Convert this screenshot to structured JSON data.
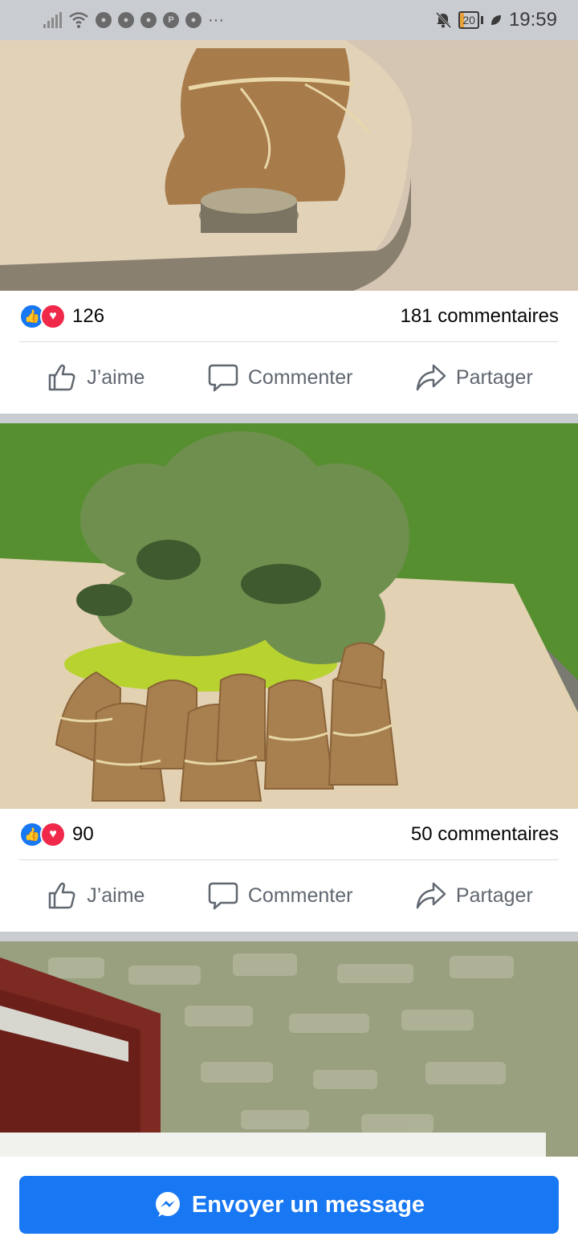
{
  "status_bar": {
    "time": "19:59",
    "battery": "20",
    "more": "···",
    "icons": [
      "signal-icon",
      "wifi-icon",
      "app-icon",
      "app-icon",
      "app-icon",
      "pinterest-icon",
      "app-icon",
      "mute-icon",
      "battery-icon",
      "leaf-icon"
    ]
  },
  "posts": [
    {
      "reaction_count": "126",
      "comment_count": "181 commentaires",
      "actions": {
        "like": "J’aime",
        "comment": "Commenter",
        "share": "Partager"
      }
    },
    {
      "reaction_count": "90",
      "comment_count": "50 commentaires",
      "actions": {
        "like": "J’aime",
        "comment": "Commenter",
        "share": "Partager"
      }
    }
  ],
  "message_button": {
    "label": "Envoyer un message"
  },
  "colors": {
    "accent": "#1877f2",
    "love": "#f02849",
    "muted": "#606770",
    "separator": "#c9ccd1"
  }
}
